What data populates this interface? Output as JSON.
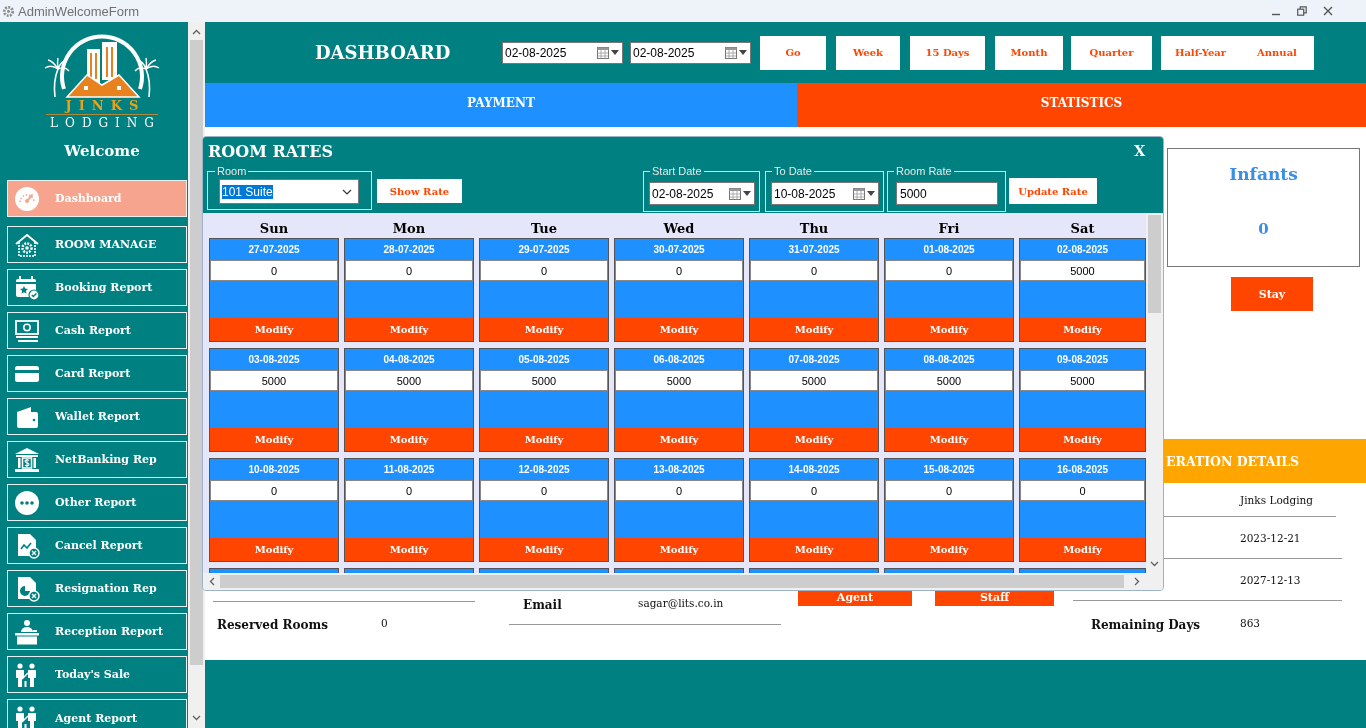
{
  "window": {
    "title": "AdminWelcomeForm"
  },
  "sidebar": {
    "logo": {
      "name": "JINKS",
      "subtitle": "LODGING"
    },
    "welcome": "Welcome",
    "items": [
      {
        "label": "Dashboard",
        "selected": true
      },
      {
        "label": "ROOM MANAGE",
        "selected": false
      },
      {
        "label": "Booking Report",
        "selected": false
      },
      {
        "label": "Cash Report",
        "selected": false
      },
      {
        "label": "Card Report",
        "selected": false
      },
      {
        "label": "Wallet Report",
        "selected": false
      },
      {
        "label": "NetBanking Rep",
        "selected": false
      },
      {
        "label": "Other Report",
        "selected": false
      },
      {
        "label": "Cancel Report",
        "selected": false
      },
      {
        "label": "Resignation Rep",
        "selected": false
      },
      {
        "label": "Reception Report",
        "selected": false
      },
      {
        "label": "Today's Sale",
        "selected": false
      },
      {
        "label": "Agent Report",
        "selected": false
      }
    ]
  },
  "header": {
    "title": "DASHBOARD",
    "from_date": "02-08-2025",
    "to_date": "02-08-2025",
    "buttons": [
      "Go",
      "Week",
      "15 Days",
      "Month",
      "Quarter",
      "Half-Year",
      "Annual"
    ]
  },
  "tabs": [
    {
      "label": "PAYMENT",
      "color": "#1e90ff"
    },
    {
      "label": "STATISTICS",
      "color": "#ff4500"
    }
  ],
  "stats_card": {
    "title": "Infants",
    "value": "0",
    "button": "Stay"
  },
  "reserved": {
    "label": "Reserved Rooms",
    "value": "0"
  },
  "email": {
    "label": "Email",
    "value": "sagar@lits.co.in"
  },
  "staff_buttons": [
    "Agent",
    "Staff"
  ],
  "details": {
    "title": "ERATION DETAILS",
    "rows": [
      {
        "value": "Jinks Lodging"
      },
      {
        "value": "2023-12-21"
      },
      {
        "value": "2027-12-13"
      },
      {
        "label": "Remaining Days",
        "value": "863"
      }
    ]
  },
  "dialog": {
    "title": "ROOM RATES",
    "close": "X",
    "room": {
      "legend": "Room",
      "value": "101 Suite",
      "focused": true
    },
    "show_rate": "Show Rate",
    "start_date": {
      "legend": "Start Date",
      "value": "02-08-2025"
    },
    "to_date": {
      "legend": "To Date",
      "value": "10-08-2025"
    },
    "room_rate": {
      "legend": "Room Rate",
      "value": "5000"
    },
    "update_rate": "Update Rate",
    "weekdays": [
      "Sun",
      "Mon",
      "Tue",
      "Wed",
      "Thu",
      "Fri",
      "Sat"
    ],
    "weeks": [
      [
        {
          "date": "27-07-2025",
          "rate": "0",
          "button": "Modify"
        },
        {
          "date": "28-07-2025",
          "rate": "0",
          "button": "Modify"
        },
        {
          "date": "29-07-2025",
          "rate": "0",
          "button": "Modify"
        },
        {
          "date": "30-07-2025",
          "rate": "0",
          "button": "Modify"
        },
        {
          "date": "31-07-2025",
          "rate": "0",
          "button": "Modify"
        },
        {
          "date": "01-08-2025",
          "rate": "0",
          "button": "Modify"
        },
        {
          "date": "02-08-2025",
          "rate": "5000",
          "button": "Modify"
        }
      ],
      [
        {
          "date": "03-08-2025",
          "rate": "5000",
          "button": "Modify"
        },
        {
          "date": "04-08-2025",
          "rate": "5000",
          "button": "Modify"
        },
        {
          "date": "05-08-2025",
          "rate": "5000",
          "button": "Modify"
        },
        {
          "date": "06-08-2025",
          "rate": "5000",
          "button": "Modify"
        },
        {
          "date": "07-08-2025",
          "rate": "5000",
          "button": "Modify"
        },
        {
          "date": "08-08-2025",
          "rate": "5000",
          "button": "Modify"
        },
        {
          "date": "09-08-2025",
          "rate": "5000",
          "button": "Modify"
        }
      ],
      [
        {
          "date": "10-08-2025",
          "rate": "0",
          "button": "Modify"
        },
        {
          "date": "11-08-2025",
          "rate": "0",
          "button": "Modify"
        },
        {
          "date": "12-08-2025",
          "rate": "0",
          "button": "Modify"
        },
        {
          "date": "13-08-2025",
          "rate": "0",
          "button": "Modify"
        },
        {
          "date": "14-08-2025",
          "rate": "0",
          "button": "Modify"
        },
        {
          "date": "15-08-2025",
          "rate": "0",
          "button": "Modify"
        },
        {
          "date": "16-08-2025",
          "rate": "0",
          "button": "Modify"
        }
      ]
    ]
  }
}
